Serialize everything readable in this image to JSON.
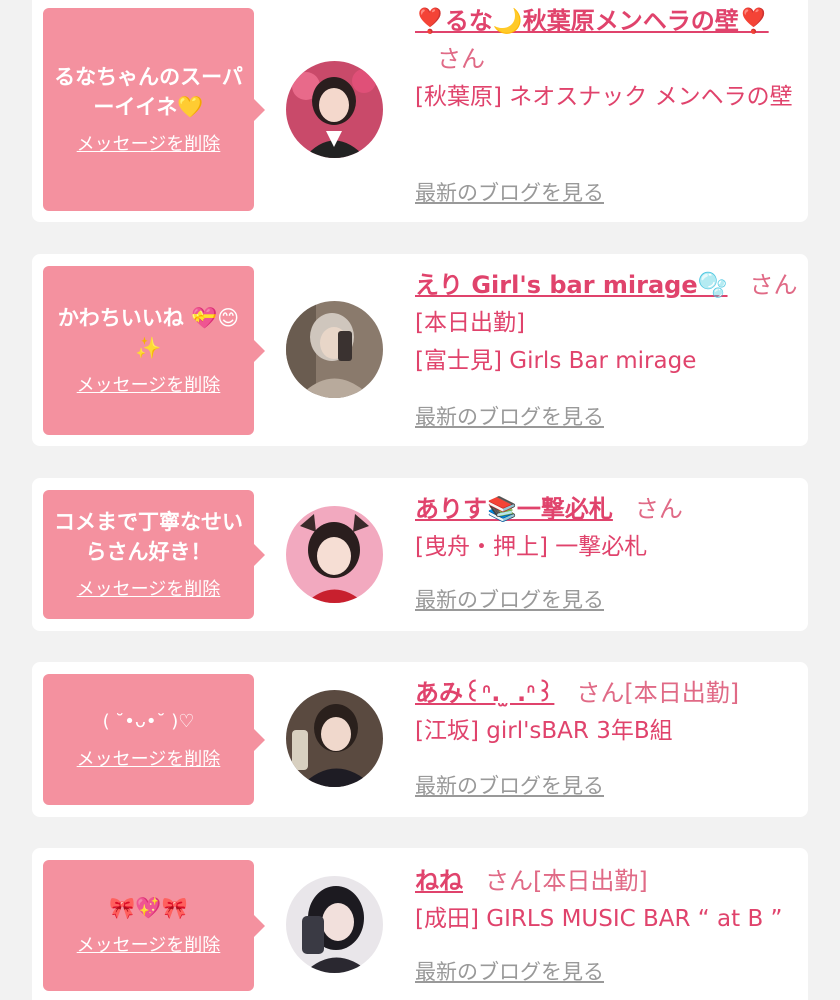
{
  "items": [
    {
      "comment": "るなちゃんのスーパーイイネ💛",
      "delete_label": "メッセージを削除",
      "name": "❣️るな🌙秋葉原メンヘラの壁❣️",
      "san_label": "さん",
      "lines": [
        "[秋葉原] ネオスナック メンヘラの壁"
      ],
      "blog_label": "最新のブログを見る",
      "avatar_icon": "avatar-photo-icon"
    },
    {
      "comment": "かわちいいね 💝😊✨",
      "delete_label": "メッセージを削除",
      "name": "えり Girl's bar mirage🫧",
      "san_label": "さん",
      "lines": [
        "[本日出勤]",
        "[富士見] Girls Bar mirage"
      ],
      "blog_label": "最新のブログを見る",
      "avatar_icon": "avatar-photo-icon"
    },
    {
      "comment": "コメまで丁寧なせいらさん好き！",
      "delete_label": "メッセージを削除",
      "name": "ありす📚一撃必札",
      "san_label": "さん",
      "lines": [
        "[曳舟・押上] 一撃必札"
      ],
      "blog_label": "最新のブログを見る",
      "avatar_icon": "avatar-photo-icon"
    },
    {
      "comment": "( ˘•ᴗ•˘ )♡",
      "delete_label": "メッセージを削除",
      "name": "あみ꒰ᐢ. ̫ .ᐢ꒱",
      "san_label": "さん[本日出勤]",
      "lines": [
        "[江坂] girl'sBAR 3年B組"
      ],
      "blog_label": "最新のブログを見る",
      "avatar_icon": "avatar-photo-icon"
    },
    {
      "comment": "🎀💖🎀",
      "delete_label": "メッセージを削除",
      "name": "ねね",
      "san_label": "さん[本日出勤]",
      "lines": [
        "[成田] GIRLS MUSIC BAR “ at B ”"
      ],
      "blog_label": "最新のブログを見る",
      "avatar_icon": "avatar-photo-icon"
    }
  ],
  "colors": {
    "page_bg": "#f2f2f2",
    "card_bg": "#ffffff",
    "bubble": "#f4919f",
    "name": "#e0436c",
    "link_gray": "#999999"
  }
}
